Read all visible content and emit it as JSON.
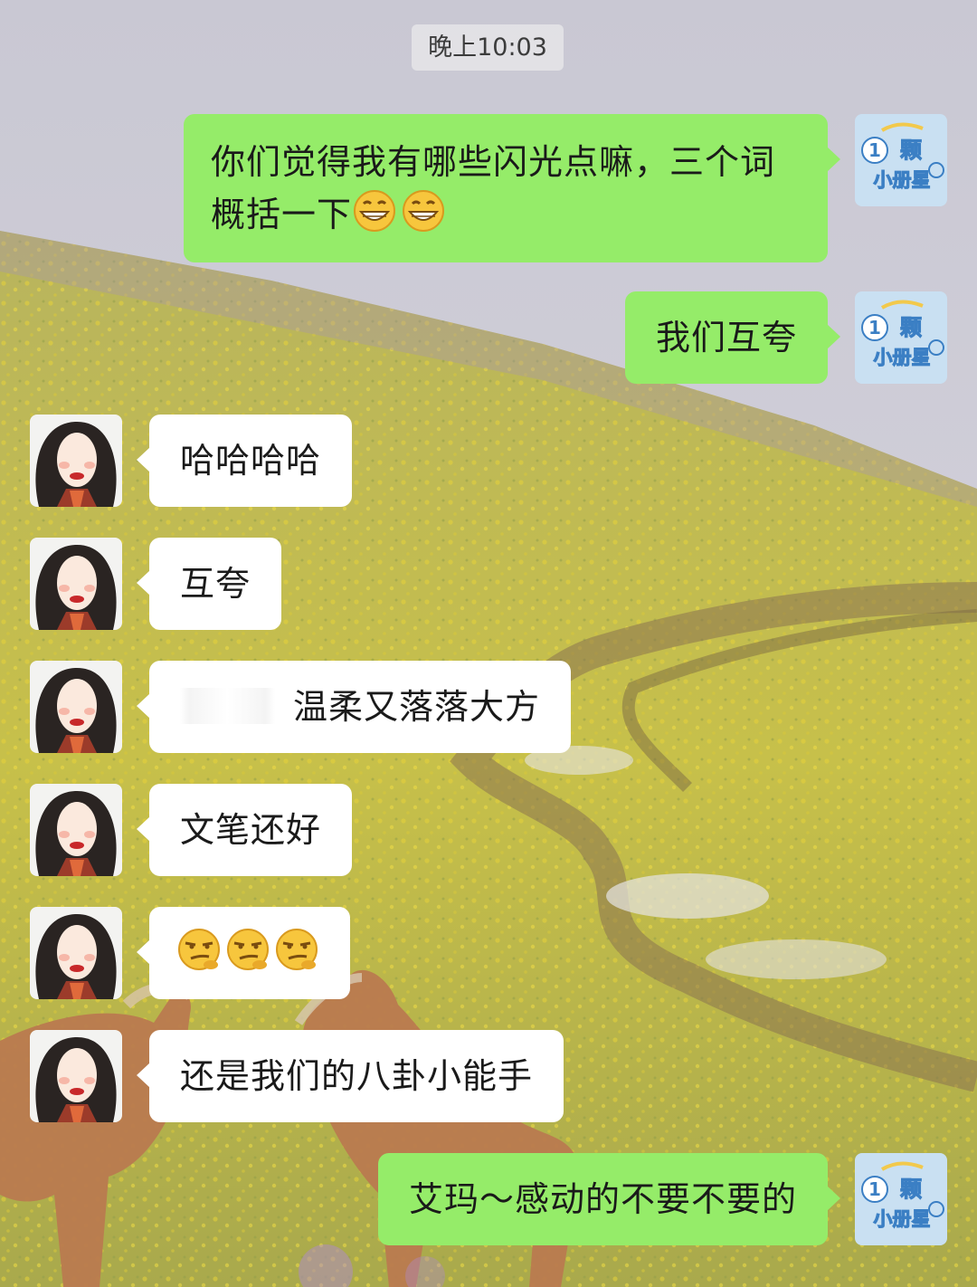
{
  "chat": {
    "timestamp": "晚上10:03",
    "messages": [
      {
        "side": "out",
        "text": "你们觉得我有哪些闪光点嘛，三个词概括一下",
        "emoji": [
          "grin-emoji",
          "grin-emoji"
        ]
      },
      {
        "side": "out",
        "text": "我们互夸"
      },
      {
        "side": "in",
        "text": "哈哈哈哈"
      },
      {
        "side": "in",
        "text": "互夸"
      },
      {
        "side": "in",
        "text": "温柔又落落大方",
        "redacted_prefix": true
      },
      {
        "side": "in",
        "text": "文笔还好"
      },
      {
        "side": "in",
        "text": "",
        "emoji": [
          "smirk-emoji",
          "smirk-emoji",
          "smirk-emoji"
        ]
      },
      {
        "side": "in",
        "text": "还是我们的八卦小能手"
      },
      {
        "side": "out",
        "text": "艾玛～感动的不要不要的"
      }
    ]
  },
  "self_avatar": {
    "badge_number": "1",
    "badge_text_top": "颗",
    "badge_text_bottom": "小册星",
    "icon": "planet-badge-avatar"
  },
  "friend_avatar": {
    "icon": "cartoon-girl-avatar"
  },
  "colors": {
    "outgoing_bubble": "#95ec69",
    "incoming_bubble": "#ffffff",
    "timestamp_bg": "#e6e6e9"
  }
}
